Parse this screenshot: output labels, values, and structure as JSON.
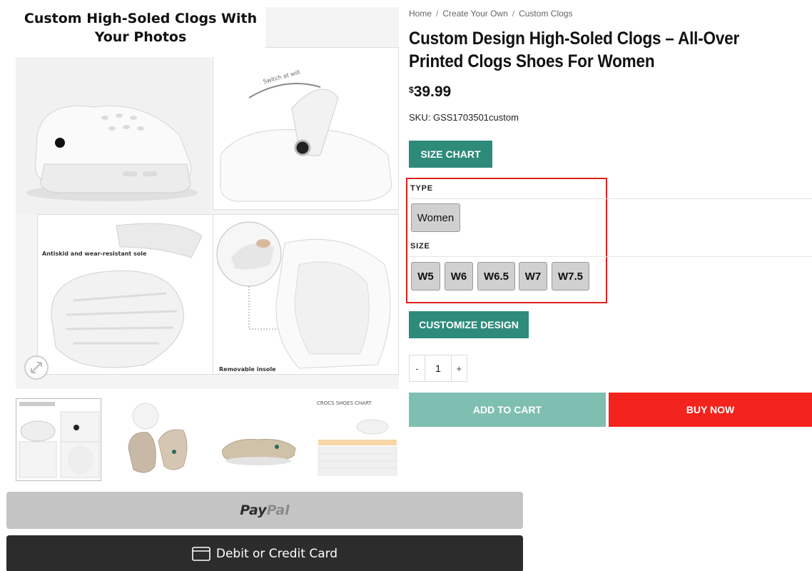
{
  "gallery": {
    "title_line1": "Custom High-Soled Clogs With",
    "title_line2": "Your Photos",
    "panel_switch_text": "Switch at will",
    "panel_antiskid_text": "Antiskid and wear-resistant sole",
    "panel_insole_text": "Removable insole"
  },
  "thumbnails": {
    "chart_title": "CROCS SHOES CHART"
  },
  "payment": {
    "paypal_part1": "Pay",
    "paypal_part2": "Pal",
    "card_label": "Debit or Credit Card"
  },
  "breadcrumb": {
    "items": [
      "Home",
      "Create Your Own",
      "Custom Clogs"
    ],
    "separator": "/"
  },
  "product": {
    "title": "Custom Design High-Soled Clogs – All-Over Printed Clogs Shoes For Women",
    "currency": "$",
    "price": "39.99",
    "sku_label": "SKU:",
    "sku": "GSS1703501custom"
  },
  "buttons": {
    "size_chart": "SIZE CHART",
    "customize": "CUSTOMIZE DESIGN",
    "add_to_cart": "ADD TO CART",
    "buy_now": "BUY NOW"
  },
  "variations": {
    "type_label": "TYPE",
    "types": [
      "Women"
    ],
    "size_label": "SIZE",
    "sizes": [
      "W5",
      "W6",
      "W6.5",
      "W7",
      "W7.5"
    ]
  },
  "quantity": {
    "minus": "-",
    "value": "1",
    "plus": "+"
  },
  "colors": {
    "accent_teal": "#2e8b7a",
    "add_to_cart": "#7fbfb1",
    "buy_now": "#f2241d",
    "highlight_box": "#e02020"
  }
}
